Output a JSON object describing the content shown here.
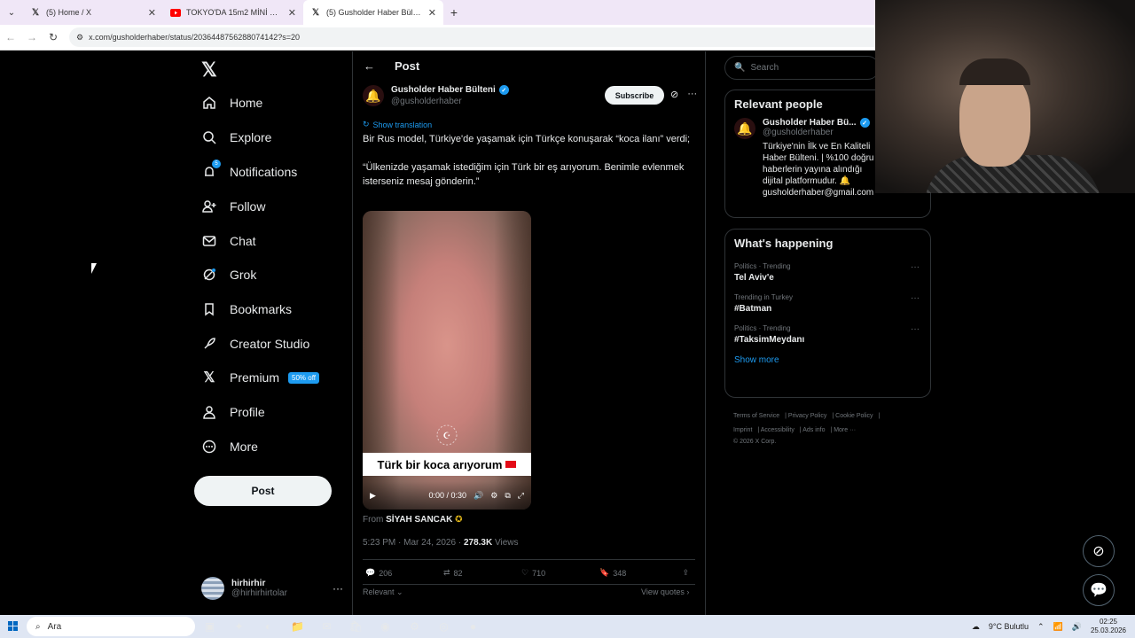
{
  "browser": {
    "tabs": [
      {
        "title": "(5) Home / X",
        "favicon": "x-icon",
        "active": false
      },
      {
        "title": "TOKYO'DA 15m2 MİNİ DAİRE /",
        "favicon": "youtube-icon",
        "active": false
      },
      {
        "title": "(5) Gusholder Haber Bülteni on",
        "favicon": "x-icon",
        "active": true
      }
    ],
    "url": "x.com/gusholderhaber/status/2036448756288074142?s=20"
  },
  "sidebar": {
    "items": [
      {
        "label": "Home",
        "icon": "home-icon"
      },
      {
        "label": "Explore",
        "icon": "search-icon"
      },
      {
        "label": "Notifications",
        "icon": "bell-icon",
        "badge": "5"
      },
      {
        "label": "Follow",
        "icon": "person-plus-icon"
      },
      {
        "label": "Chat",
        "icon": "mail-icon"
      },
      {
        "label": "Grok",
        "icon": "grok-icon"
      },
      {
        "label": "Bookmarks",
        "icon": "bookmark-icon"
      },
      {
        "label": "Creator Studio",
        "icon": "rocket-icon"
      },
      {
        "label": "Premium",
        "icon": "x-icon",
        "badge": "50% off"
      },
      {
        "label": "Profile",
        "icon": "person-icon"
      },
      {
        "label": "More",
        "icon": "more-circle-icon"
      }
    ],
    "post_label": "Post",
    "account": {
      "name": "hirhirhir",
      "handle": "@hirhirhirtolar"
    }
  },
  "post": {
    "header": "Post",
    "author_name": "Gusholder Haber Bülteni",
    "author_handle": "@gusholderhaber",
    "subscribe_label": "Subscribe",
    "show_translation": "Show translation",
    "text_line1": "Bir Rus model, Türkiye'de yaşamak için Türkçe konuşarak “koca ilanı” verdi;",
    "text_line2": "“Ülkenizde yaşamak istediğim için Türk bir eş arıyorum. Benimle evlenmek isterseniz mesaj gönderin.”",
    "video_caption": "Türk bir koca arıyorum",
    "video_time": "0:00 / 0:30",
    "from_label": "From",
    "from_source": "SİYAH SANCAK",
    "timestamp": "5:23 PM · Mar 24, 2026 ·",
    "views_count": "278.3K",
    "views_label": "Views",
    "replies": "206",
    "reposts": "82",
    "likes": "710",
    "bookmarks": "348",
    "relevant_label": "Relevant",
    "view_quotes": "View quotes"
  },
  "right": {
    "search_placeholder": "Search",
    "relevant_people_title": "Relevant people",
    "person": {
      "name": "Gusholder Haber Bü...",
      "handle": "@gusholderhaber",
      "bio": "Türkiye'nin İlk ve En Kaliteli Haber Bülteni. | %100 doğru haberlerin yayına alındığı dijital platformudur. 🔔 gusholderhaber@gmail.com"
    },
    "whats_happening_title": "What's happening",
    "trends": [
      {
        "category": "Politics · Trending",
        "title": "Tel Aviv'e"
      },
      {
        "category": "Trending in Turkey",
        "title": "#Batman"
      },
      {
        "category": "Politics · Trending",
        "title": "#TaksimMeydanı"
      }
    ],
    "show_more": "Show more",
    "footer_links": [
      "Terms of Service",
      "Privacy Policy",
      "Cookie Policy",
      "Imprint",
      "Accessibility",
      "Ads info",
      "More ···"
    ],
    "copyright": "© 2026 X Corp."
  },
  "taskbar": {
    "search_label": "Ara",
    "weather": "9°C  Bulutlu",
    "time": "02:25",
    "date": "25.03.2026"
  }
}
